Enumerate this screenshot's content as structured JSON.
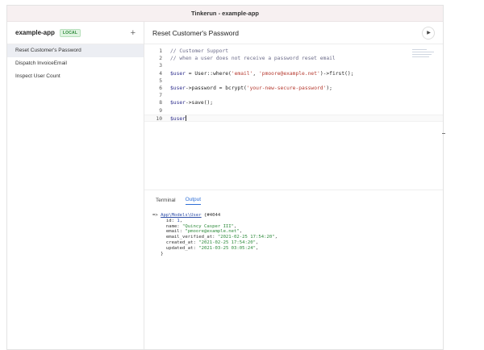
{
  "window": {
    "title": "Tinkerun - example-app"
  },
  "sidebar": {
    "app_name": "example-app",
    "badge": "LOCAL",
    "add_label": "+",
    "items": [
      {
        "label": "Reset Customer's Password"
      },
      {
        "label": "Dispatch InvoiceEmail"
      },
      {
        "label": "Inspect User Count"
      }
    ]
  },
  "main": {
    "title": "Reset Customer's Password",
    "run_icon": "play-icon"
  },
  "editor": {
    "lines": [
      {
        "n": "1",
        "parts": [
          {
            "t": "// Customer Support",
            "c": "cm"
          }
        ]
      },
      {
        "n": "2",
        "parts": [
          {
            "t": "// when a user does not receive a password reset email",
            "c": "cm"
          }
        ]
      },
      {
        "n": "3",
        "parts": []
      },
      {
        "n": "4",
        "parts": [
          {
            "t": "$user",
            "c": "var"
          },
          {
            "t": " = User::where(",
            "c": ""
          },
          {
            "t": "'email'",
            "c": "str"
          },
          {
            "t": ", ",
            "c": ""
          },
          {
            "t": "'pmoore@example.net'",
            "c": "str"
          },
          {
            "t": ")->first();",
            "c": ""
          }
        ]
      },
      {
        "n": "5",
        "parts": []
      },
      {
        "n": "6",
        "parts": [
          {
            "t": "$user",
            "c": "var"
          },
          {
            "t": "->password = bcrypt(",
            "c": ""
          },
          {
            "t": "'your-new-secure-password'",
            "c": "str"
          },
          {
            "t": ");",
            "c": ""
          }
        ]
      },
      {
        "n": "7",
        "parts": []
      },
      {
        "n": "8",
        "parts": [
          {
            "t": "$user",
            "c": "var"
          },
          {
            "t": "->save();",
            "c": ""
          }
        ]
      },
      {
        "n": "9",
        "parts": []
      },
      {
        "n": "10",
        "parts": [
          {
            "t": "$user",
            "c": "var"
          }
        ]
      }
    ]
  },
  "output_panel": {
    "tabs": [
      {
        "label": "Terminal"
      },
      {
        "label": "Output"
      }
    ],
    "lines": [
      [
        {
          "t": "=> ",
          "c": ""
        },
        {
          "t": "App\\Models\\User",
          "c": "o-class"
        },
        {
          "t": " {#4044",
          "c": ""
        }
      ],
      [
        {
          "t": "     id: ",
          "c": "o-key"
        },
        {
          "t": "1",
          "c": "o-num"
        },
        {
          "t": ",",
          "c": ""
        }
      ],
      [
        {
          "t": "     name: ",
          "c": "o-key"
        },
        {
          "t": "\"Quincy Casper III\"",
          "c": "o-str"
        },
        {
          "t": ",",
          "c": ""
        }
      ],
      [
        {
          "t": "     email: ",
          "c": "o-key"
        },
        {
          "t": "\"pmoore@example.net\"",
          "c": "o-str"
        },
        {
          "t": ",",
          "c": ""
        }
      ],
      [
        {
          "t": "     email_verified_at: ",
          "c": "o-key"
        },
        {
          "t": "\"2021-02-25 17:54:20\"",
          "c": "o-str"
        },
        {
          "t": ",",
          "c": ""
        }
      ],
      [
        {
          "t": "     created_at: ",
          "c": "o-key"
        },
        {
          "t": "\"2021-02-25 17:54:20\"",
          "c": "o-str"
        },
        {
          "t": ",",
          "c": ""
        }
      ],
      [
        {
          "t": "     updated_at: ",
          "c": "o-key"
        },
        {
          "t": "\"2021-03-25 03:05:24\"",
          "c": "o-str"
        },
        {
          "t": ",",
          "c": ""
        }
      ],
      [
        {
          "t": "   }",
          "c": ""
        }
      ]
    ]
  }
}
